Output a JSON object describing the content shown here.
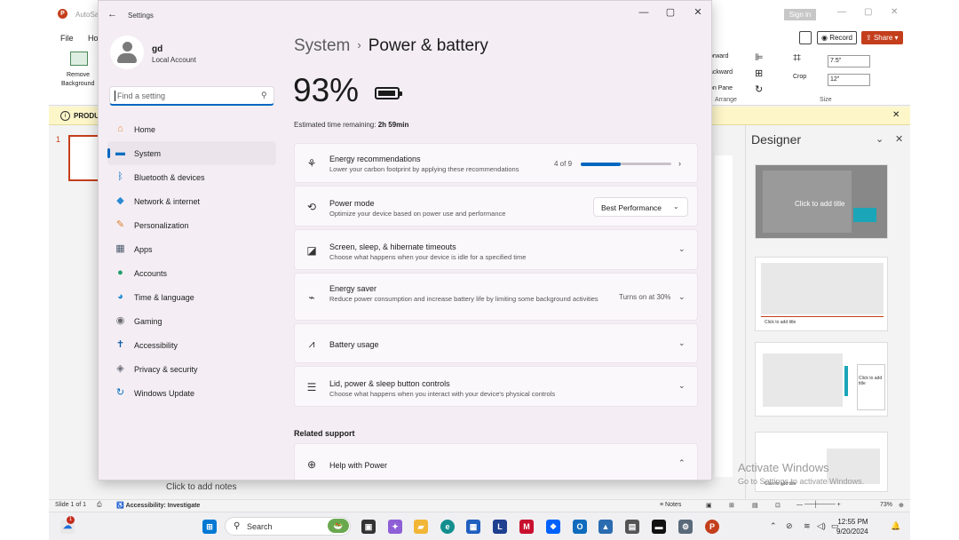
{
  "powerpoint": {
    "app_name": "AutoSa",
    "sign_in": "Sign in",
    "tabs": [
      "File",
      "Ho"
    ],
    "remove_background": [
      "Remove",
      "Background"
    ],
    "record": "Record",
    "share": "Share",
    "ribbon_right": [
      "orward",
      "ackward",
      "on Pane",
      "Arrange"
    ],
    "crop": "Crop",
    "size_label": "Size",
    "width_value": "7.5\"",
    "height_value": "12\"",
    "infobar_label": "PRODU",
    "slide_number": "1",
    "notes_placeholder": "Click to add notes",
    "designer_title": "Designer",
    "designer_card_text": "Click to add title",
    "designer_card3_text": "Click to add title",
    "activate_title": "Activate Windows",
    "activate_sub": "Go to Settings to activate Windows.",
    "status_slide": "Slide 1 of 1",
    "status_accessibility": "Accessibility: Investigate",
    "status_notes": "Notes",
    "status_zoom": "73%"
  },
  "settings": {
    "window_title": "Settings",
    "profile": {
      "name": "gd",
      "account_type": "Local Account"
    },
    "search_placeholder": "Find a setting",
    "nav": [
      {
        "label": "Home",
        "icon": "home-icon",
        "glyph": "⌂",
        "color": "#e8893a"
      },
      {
        "label": "System",
        "icon": "system-icon",
        "glyph": "▬",
        "color": "#0a6fc2"
      },
      {
        "label": "Bluetooth & devices",
        "icon": "bluetooth-icon",
        "glyph": "ᛒ",
        "color": "#0a6fc2"
      },
      {
        "label": "Network & internet",
        "icon": "wifi-icon",
        "glyph": "◆",
        "color": "#2a8ad4"
      },
      {
        "label": "Personalization",
        "icon": "brush-icon",
        "glyph": "✎",
        "color": "#d9822b"
      },
      {
        "label": "Apps",
        "icon": "apps-icon",
        "glyph": "▦",
        "color": "#4a5a6e"
      },
      {
        "label": "Accounts",
        "icon": "accounts-icon",
        "glyph": "●",
        "color": "#1e9e6a"
      },
      {
        "label": "Time & language",
        "icon": "globe-clock-icon",
        "glyph": "◕",
        "color": "#1b8ad1"
      },
      {
        "label": "Gaming",
        "icon": "gamepad-icon",
        "glyph": "◉",
        "color": "#6a6a6a"
      },
      {
        "label": "Accessibility",
        "icon": "accessibility-icon",
        "glyph": "✝",
        "color": "#0f5da8"
      },
      {
        "label": "Privacy & security",
        "icon": "shield-icon",
        "glyph": "◈",
        "color": "#6d6d7a"
      },
      {
        "label": "Windows Update",
        "icon": "update-icon",
        "glyph": "↻",
        "color": "#0a6fc2"
      }
    ],
    "active_nav": "System",
    "breadcrumb": {
      "parent": "System",
      "separator": "›",
      "current": "Power & battery"
    },
    "battery_percent": "93%",
    "battery_level": 0.93,
    "estimated_label": "Estimated time remaining:",
    "estimated_value": "2h 59min",
    "cards": {
      "energy": {
        "title": "Energy recommendations",
        "desc": "Lower your carbon footprint by applying these recommendations",
        "count": "4 of 9",
        "progress": 0.44
      },
      "power_mode": {
        "title": "Power mode",
        "desc": "Optimize your device based on power use and performance",
        "value": "Best Performance"
      },
      "screen": {
        "title": "Screen, sleep, & hibernate timeouts",
        "desc": "Choose what happens when your device is idle for a specified time"
      },
      "saver": {
        "title": "Energy saver",
        "desc": "Reduce power consumption and increase battery life by limiting some background activities",
        "status": "Turns on at 30%"
      },
      "usage": {
        "title": "Battery usage"
      },
      "lid": {
        "title": "Lid, power & sleep button controls",
        "desc": "Choose what happens when you interact with your device's physical controls"
      },
      "help": {
        "title": "Help with Power"
      }
    },
    "related_support": "Related support"
  },
  "taskbar": {
    "search_label": "Search",
    "notification_count": "1",
    "time": "12:55 PM",
    "date": "9/20/2024"
  }
}
